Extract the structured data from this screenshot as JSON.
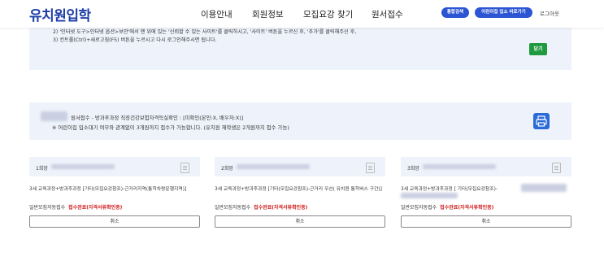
{
  "header": {
    "logo": "유치원입학",
    "nav": [
      "이용안내",
      "회원정보",
      "모집요강 찾기",
      "원서접수"
    ],
    "unified_search": "통합검색",
    "waiting_shortcut": "어린이집 입소 바로가기",
    "logout": "로그아웃"
  },
  "notice": {
    "line1": "2) '인터넷 도구>인터넷 옵션>보안'에서 맨 위에 있는 '신뢰할 수 있는 사이트'를 클릭하시고, '사이트' 버튼을 누르신 후, '추가'를 클릭해주신 후,",
    "line2": "3) 컨트롤(Ctrl)+새로고침(F5) 버튼을 누르시고 다시 로그인해주시면 됩니다.",
    "close": "닫기"
  },
  "application_info": {
    "line1": "원서접수 - 방과후과정 직장건강보험자격득실확인 : [미확인(본인:X, 배우자:X)]",
    "line2": "※ 어린이집 입소대기 여부와 관계없이 3개원까지 접수가 가능합니다. (유치원 재학생은 2개원까지 접수 가능)"
  },
  "cards": [
    {
      "rank": "1희망",
      "title": "3세 교육과정+방과후과정 [기타(모집요강참조)-근거리지역(통학차량운행지역)]",
      "type": "일반모집자동접수",
      "status": "접수완료(자격서류확인중)",
      "cancel": "취소"
    },
    {
      "rank": "2희망",
      "title": "3세 교육과정+방과후과정 [기타(모집요강참조)-근거리 우선( 유치원 통학버스 구간)]",
      "type": "일반모집자동접수",
      "status": "접수완료(자격서류확인중)",
      "cancel": "취소"
    },
    {
      "rank": "3희망",
      "title": "3세 교육과정+방과후과정 [ 기타(모집요강참조)-",
      "type": "일반모집자동접수",
      "status": "접수완료(자격서류확인중)",
      "cancel": "취소"
    }
  ],
  "colors": {
    "brand": "#1e3fa8",
    "accent": "#2b55d3",
    "status_red": "#d21f1f",
    "close_green": "#1f9a3f"
  }
}
